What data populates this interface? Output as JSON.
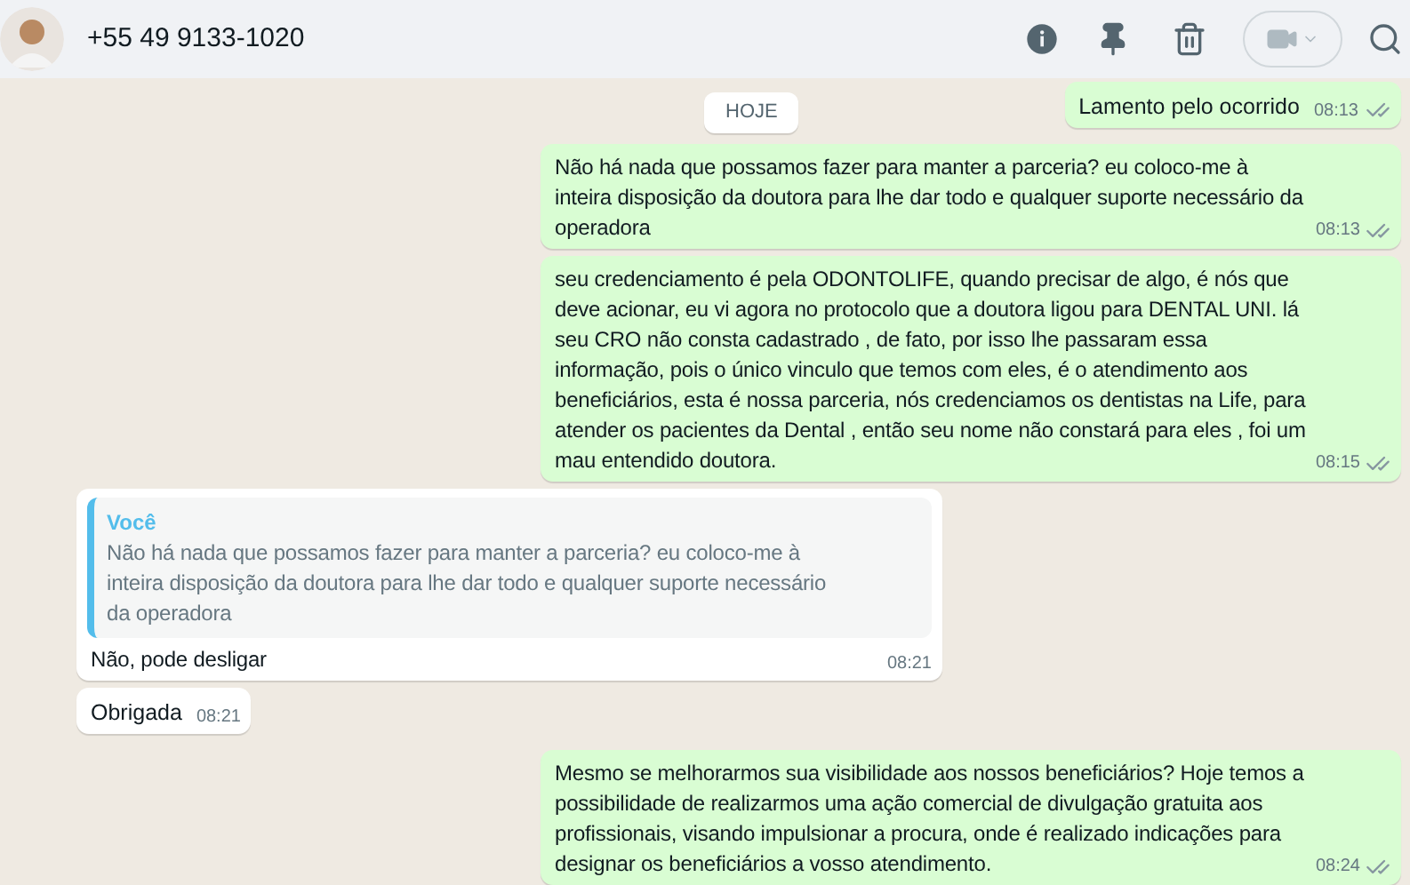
{
  "header": {
    "contact": "+55 49 9133-1020"
  },
  "date_chip": "HOJE",
  "messages": [
    {
      "kind": "out",
      "text": "Lamento pelo ocorrido",
      "time": "08:13",
      "read": true
    },
    {
      "kind": "out",
      "text": "Não há nada que possamos fazer para manter a parceria? eu coloco-me à inteira disposição da doutora para lhe dar todo e qualquer suporte necessário da operadora",
      "time": "08:13",
      "read": true
    },
    {
      "kind": "out",
      "text": "seu credenciamento é pela ODONTOLIFE, quando precisar de algo, é nós que deve acionar, eu vi agora no protocolo que a doutora ligou para DENTAL UNI. lá seu CRO não consta cadastrado , de fato, por isso lhe passaram essa informação, pois o único vinculo que temos com eles, é o atendimento aos beneficiários, esta é nossa parceria, nós credenciamos os dentistas na Life, para atender os pacientes da Dental , então seu nome não constará para eles , foi um mau entendido doutora.",
      "time": "08:15",
      "read": true
    },
    {
      "kind": "in",
      "quote": {
        "author": "Você",
        "text": "Não há nada que possamos fazer para manter a parceria? eu coloco-me à inteira disposição da doutora para lhe dar todo e qualquer suporte necessário da operadora"
      },
      "text": "Não, pode desligar",
      "time": "08:21"
    },
    {
      "kind": "in",
      "text": "Obrigada",
      "time": "08:21"
    },
    {
      "kind": "out",
      "text": "Mesmo se melhorarmos sua visibilidade aos nossos beneficiários? Hoje temos a possibilidade de realizarmos uma ação comercial de divulgação gratuita aos profissionais, visando impulsionar a procura, onde é realizado indicações para designar os beneficiários a vosso atendimento.",
      "time": "08:24",
      "read": true
    }
  ]
}
